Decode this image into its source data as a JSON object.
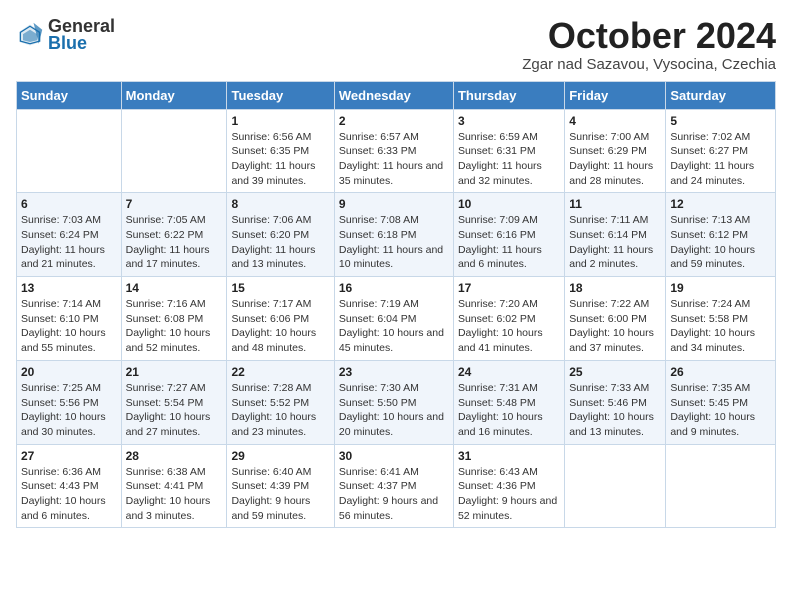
{
  "header": {
    "logo_general": "General",
    "logo_blue": "Blue",
    "month": "October 2024",
    "location": "Zgar nad Sazavou, Vysocina, Czechia"
  },
  "days_of_week": [
    "Sunday",
    "Monday",
    "Tuesday",
    "Wednesday",
    "Thursday",
    "Friday",
    "Saturday"
  ],
  "weeks": [
    [
      {
        "num": "",
        "info": ""
      },
      {
        "num": "",
        "info": ""
      },
      {
        "num": "1",
        "info": "Sunrise: 6:56 AM\nSunset: 6:35 PM\nDaylight: 11 hours and 39 minutes."
      },
      {
        "num": "2",
        "info": "Sunrise: 6:57 AM\nSunset: 6:33 PM\nDaylight: 11 hours and 35 minutes."
      },
      {
        "num": "3",
        "info": "Sunrise: 6:59 AM\nSunset: 6:31 PM\nDaylight: 11 hours and 32 minutes."
      },
      {
        "num": "4",
        "info": "Sunrise: 7:00 AM\nSunset: 6:29 PM\nDaylight: 11 hours and 28 minutes."
      },
      {
        "num": "5",
        "info": "Sunrise: 7:02 AM\nSunset: 6:27 PM\nDaylight: 11 hours and 24 minutes."
      }
    ],
    [
      {
        "num": "6",
        "info": "Sunrise: 7:03 AM\nSunset: 6:24 PM\nDaylight: 11 hours and 21 minutes."
      },
      {
        "num": "7",
        "info": "Sunrise: 7:05 AM\nSunset: 6:22 PM\nDaylight: 11 hours and 17 minutes."
      },
      {
        "num": "8",
        "info": "Sunrise: 7:06 AM\nSunset: 6:20 PM\nDaylight: 11 hours and 13 minutes."
      },
      {
        "num": "9",
        "info": "Sunrise: 7:08 AM\nSunset: 6:18 PM\nDaylight: 11 hours and 10 minutes."
      },
      {
        "num": "10",
        "info": "Sunrise: 7:09 AM\nSunset: 6:16 PM\nDaylight: 11 hours and 6 minutes."
      },
      {
        "num": "11",
        "info": "Sunrise: 7:11 AM\nSunset: 6:14 PM\nDaylight: 11 hours and 2 minutes."
      },
      {
        "num": "12",
        "info": "Sunrise: 7:13 AM\nSunset: 6:12 PM\nDaylight: 10 hours and 59 minutes."
      }
    ],
    [
      {
        "num": "13",
        "info": "Sunrise: 7:14 AM\nSunset: 6:10 PM\nDaylight: 10 hours and 55 minutes."
      },
      {
        "num": "14",
        "info": "Sunrise: 7:16 AM\nSunset: 6:08 PM\nDaylight: 10 hours and 52 minutes."
      },
      {
        "num": "15",
        "info": "Sunrise: 7:17 AM\nSunset: 6:06 PM\nDaylight: 10 hours and 48 minutes."
      },
      {
        "num": "16",
        "info": "Sunrise: 7:19 AM\nSunset: 6:04 PM\nDaylight: 10 hours and 45 minutes."
      },
      {
        "num": "17",
        "info": "Sunrise: 7:20 AM\nSunset: 6:02 PM\nDaylight: 10 hours and 41 minutes."
      },
      {
        "num": "18",
        "info": "Sunrise: 7:22 AM\nSunset: 6:00 PM\nDaylight: 10 hours and 37 minutes."
      },
      {
        "num": "19",
        "info": "Sunrise: 7:24 AM\nSunset: 5:58 PM\nDaylight: 10 hours and 34 minutes."
      }
    ],
    [
      {
        "num": "20",
        "info": "Sunrise: 7:25 AM\nSunset: 5:56 PM\nDaylight: 10 hours and 30 minutes."
      },
      {
        "num": "21",
        "info": "Sunrise: 7:27 AM\nSunset: 5:54 PM\nDaylight: 10 hours and 27 minutes."
      },
      {
        "num": "22",
        "info": "Sunrise: 7:28 AM\nSunset: 5:52 PM\nDaylight: 10 hours and 23 minutes."
      },
      {
        "num": "23",
        "info": "Sunrise: 7:30 AM\nSunset: 5:50 PM\nDaylight: 10 hours and 20 minutes."
      },
      {
        "num": "24",
        "info": "Sunrise: 7:31 AM\nSunset: 5:48 PM\nDaylight: 10 hours and 16 minutes."
      },
      {
        "num": "25",
        "info": "Sunrise: 7:33 AM\nSunset: 5:46 PM\nDaylight: 10 hours and 13 minutes."
      },
      {
        "num": "26",
        "info": "Sunrise: 7:35 AM\nSunset: 5:45 PM\nDaylight: 10 hours and 9 minutes."
      }
    ],
    [
      {
        "num": "27",
        "info": "Sunrise: 6:36 AM\nSunset: 4:43 PM\nDaylight: 10 hours and 6 minutes."
      },
      {
        "num": "28",
        "info": "Sunrise: 6:38 AM\nSunset: 4:41 PM\nDaylight: 10 hours and 3 minutes."
      },
      {
        "num": "29",
        "info": "Sunrise: 6:40 AM\nSunset: 4:39 PM\nDaylight: 9 hours and 59 minutes."
      },
      {
        "num": "30",
        "info": "Sunrise: 6:41 AM\nSunset: 4:37 PM\nDaylight: 9 hours and 56 minutes."
      },
      {
        "num": "31",
        "info": "Sunrise: 6:43 AM\nSunset: 4:36 PM\nDaylight: 9 hours and 52 minutes."
      },
      {
        "num": "",
        "info": ""
      },
      {
        "num": "",
        "info": ""
      }
    ]
  ]
}
